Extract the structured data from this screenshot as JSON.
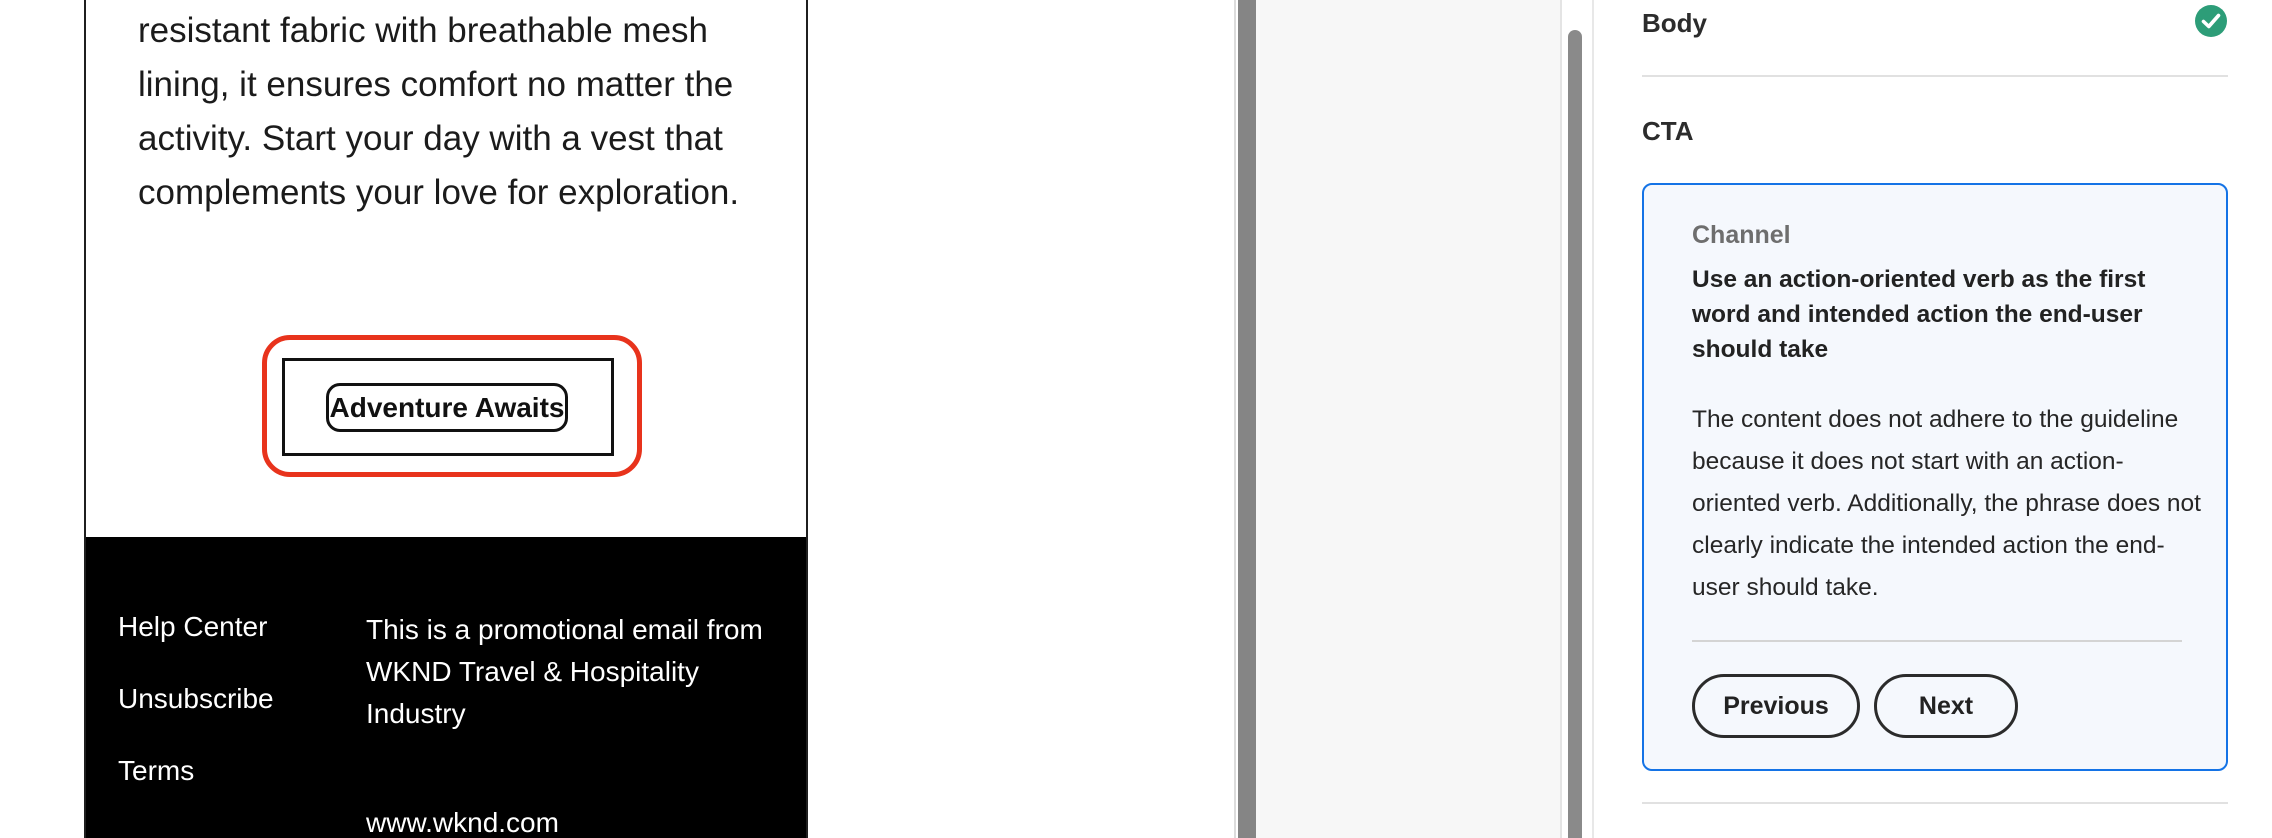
{
  "email": {
    "body_text": "resistant fabric with breathable mesh lining, it ensures comfort no matter the activity. Start your day with a vest that complements your love for exploration.",
    "cta_label": "Adventure Awaits",
    "footer": {
      "links": [
        "Help Center",
        "Unsubscribe",
        "Terms"
      ],
      "notice": "This is a promotional email from WKND Travel & Hospitality Industry",
      "website": "www.wknd.com"
    }
  },
  "checks_panel": {
    "sections": {
      "body": {
        "label": "Body",
        "status": "passed",
        "status_icon": "check-circle-icon",
        "status_color": "#2d9d78"
      },
      "cta": {
        "label": "CTA"
      }
    },
    "card": {
      "eyebrow": "Channel",
      "guideline": "Use an action-oriented verb as the first word and intended action the end-user should take",
      "explanation": "The content does not adhere to the guideline because it does not start with an action-oriented verb. Additionally, the phrase does not clearly indicate the intended action the end-user should take.",
      "previous_label": "Previous",
      "next_label": "Next"
    }
  },
  "colors": {
    "highlight": "#e8331c",
    "card_border": "#1473e6",
    "card_background": "#f5f8fd",
    "footer_background": "#000000"
  }
}
